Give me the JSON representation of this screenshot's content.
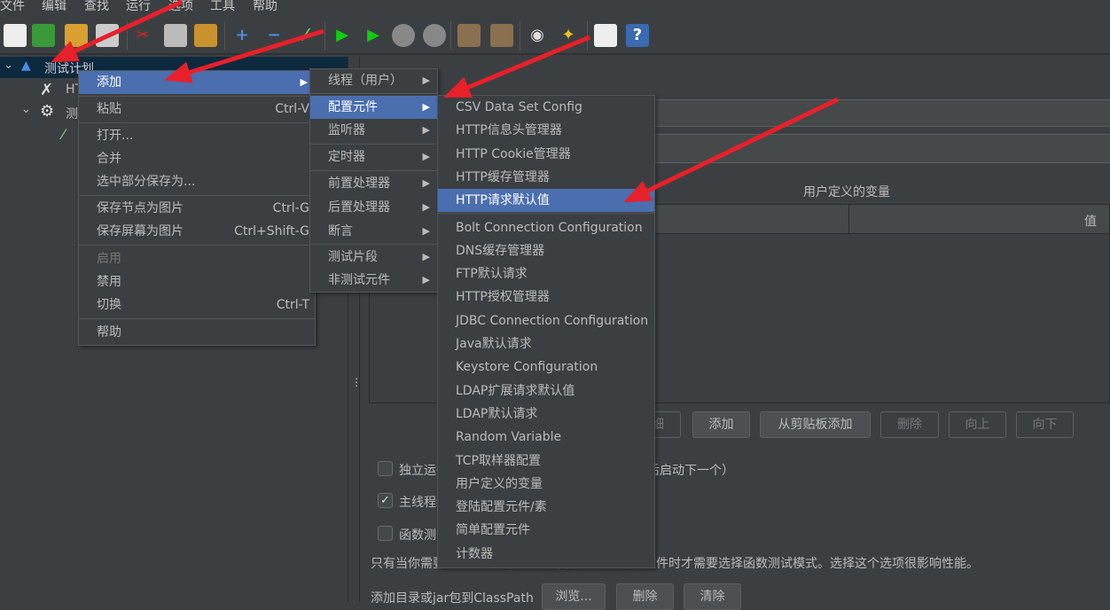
{
  "menubar": [
    "文件",
    "编辑",
    "查找",
    "运行",
    "选项",
    "工具",
    "帮助"
  ],
  "toolbar": {
    "icons": [
      "new-icon",
      "templates-icon",
      "open-icon",
      "save-icon",
      "cut-icon",
      "copy-icon",
      "paste-icon",
      "expand-icon",
      "collapse-icon",
      "toggle-icon",
      "start-icon",
      "start-no-pause-icon",
      "stop-icon",
      "shutdown-icon",
      "clear-icon",
      "clear-all-icon",
      "search-icon",
      "reset-search-icon",
      "function-helper-icon",
      "help-icon"
    ]
  },
  "tree": {
    "items": [
      {
        "label": "测试计划"
      },
      {
        "label": "HT"
      },
      {
        "label": "测"
      }
    ]
  },
  "context_menu": {
    "items": [
      {
        "label": "添加"
      },
      {
        "label": "粘贴",
        "shortcut": "Ctrl-V"
      },
      {
        "label": "打开..."
      },
      {
        "label": "合并"
      },
      {
        "label": "选中部分保存为..."
      },
      {
        "label": "保存节点为图片",
        "shortcut": "Ctrl-G"
      },
      {
        "label": "保存屏幕为图片",
        "shortcut": "Ctrl+Shift-G"
      },
      {
        "label": "启用",
        "disabled": true
      },
      {
        "label": "禁用"
      },
      {
        "label": "切换",
        "shortcut": "Ctrl-T"
      },
      {
        "label": "帮助"
      }
    ]
  },
  "add_submenu": {
    "items": [
      "线程（用户）",
      "配置元件",
      "监听器",
      "定时器",
      "前置处理器",
      "后置处理器",
      "断言",
      "测试片段",
      "非测试元件"
    ]
  },
  "config_submenu": {
    "items": [
      "CSV Data Set Config",
      "HTTP信息头管理器",
      "HTTP Cookie管理器",
      "HTTP缓存管理器",
      "HTTP请求默认值",
      "Bolt Connection Configuration",
      "DNS缓存管理器",
      "FTP默认请求",
      "HTTP授权管理器",
      "JDBC Connection Configuration",
      "Java默认请求",
      "Keystore Configuration",
      "LDAP扩展请求默认值",
      "LDAP默认请求",
      "Random Variable",
      "TCP取样器配置",
      "用户定义的变量",
      "登陆配置元件/素",
      "简单配置元件",
      "计数器"
    ],
    "selected": "HTTP请求默认值"
  },
  "main": {
    "vars_title": "用户定义的变量",
    "col_value": "值",
    "buttons": [
      "详细",
      "添加",
      "从剪贴板添加",
      "删除",
      "向上",
      "向下"
    ],
    "cb_independent": "独立运行每个线程组（例如在一个组运行结束后启动下一个）",
    "cb_teardown": "主线程结束后运行 tearDown线程组",
    "cb_functional": "函数测试模式",
    "functional_note": "只有当你需要记录每个请求从服务器取得的数据到文件时才需要选择函数测试模式。选择这个选项很影响性能。",
    "classpath_label": "添加目录或jar包到ClassPath",
    "classpath_buttons": [
      "浏览...",
      "删除",
      "清除"
    ],
    "teardown_checked": true
  },
  "colors": {
    "highlight": "#4b6eaf",
    "background": "#3c3f41",
    "tree_selected": "#0d293e",
    "annotation_arrow": "#e8202a"
  }
}
